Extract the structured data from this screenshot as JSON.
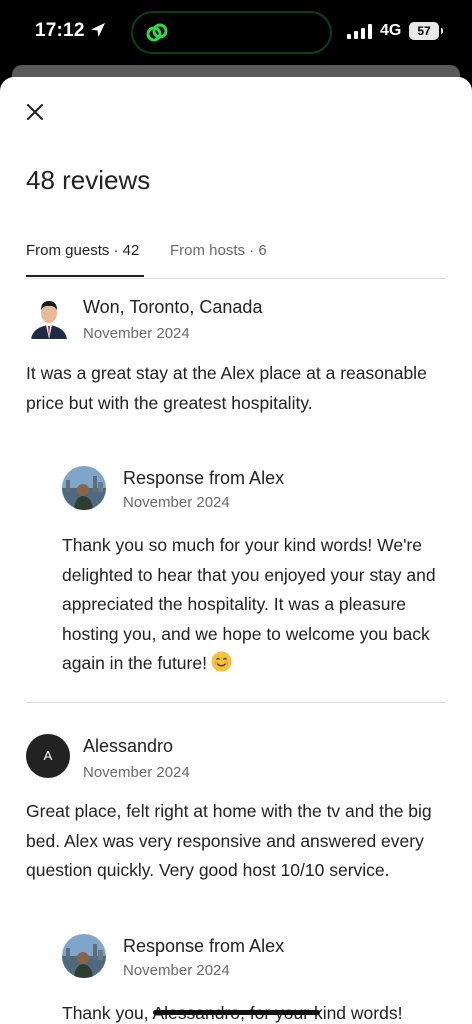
{
  "status": {
    "time": "17:12",
    "network": "4G",
    "battery": "57"
  },
  "page": {
    "title": "48 reviews"
  },
  "tabs": [
    {
      "label": "From guests · 42",
      "active": true
    },
    {
      "label": "From hosts · 6",
      "active": false
    }
  ],
  "reviews": [
    {
      "author": "Won, Toronto, Canada",
      "date": "November 2024",
      "text": "It was a great stay at the Alex place at a reasonable price but with the greatest hospitality.",
      "response": {
        "title": "Response from Alex",
        "date": "November 2024",
        "text": "Thank you so much for your kind words! We're delighted to hear that you enjoyed your stay and appreciated the hospitality. It was a pleasure hosting you, and we hope to welcome you back again in the future!"
      }
    },
    {
      "author": "Alessandro",
      "avatar_letter": "A",
      "date": "November 2024",
      "text": "Great place, felt right at home with the tv and the big bed. Alex was very responsive and answered every question quickly. Very good host 10/10 service.",
      "response": {
        "title": "Response from Alex",
        "date": "November 2024",
        "text": "Thank you, Alessandro, for your kind words!"
      }
    }
  ],
  "icons": {
    "close": "close-icon",
    "location": "location-arrow-icon",
    "signal": "signal-bars-icon",
    "emoji": "smiling-face-icon"
  },
  "colors": {
    "text": "#222222",
    "muted": "#6a6a6a",
    "divider": "#dddddd"
  }
}
